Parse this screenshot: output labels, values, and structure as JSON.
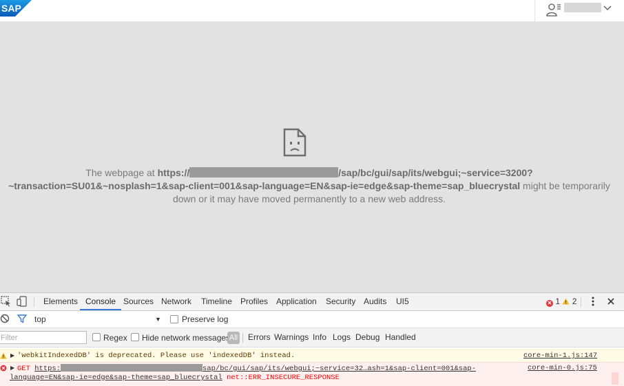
{
  "header": {
    "logo_text": "SAP",
    "brand_color": "#0a6ed1",
    "user_icon": "user-icon",
    "menu_icon": "chevron-down-icon"
  },
  "page_error": {
    "icon": "sad-document-icon",
    "prefix": "The webpage at ",
    "url_start": "https://",
    "url_path": "/sap/bc/gui/sap/its/webgui;~service=3200?",
    "url_line2": "~transaction=SU01&~nosplash=1&sap-client=001&sap-language=EN&sap-ie=edge&sap-theme=sap_bluecrystal",
    "suffix_line2": " might be temporarily",
    "line3": "down or it may have moved permanently to a new web address."
  },
  "devtools": {
    "tabs": [
      "Elements",
      "Console",
      "Sources",
      "Network",
      "Timeline",
      "Profiles",
      "Application",
      "Security",
      "Audits",
      "UI5"
    ],
    "active_tab": "Console",
    "error_count": "1",
    "warning_count": "2",
    "context": "top",
    "preserve_log_label": "Preserve log",
    "filter_placeholder": "Filter",
    "regex_label": "Regex",
    "hide_network_label": "Hide network messages",
    "levels": [
      "All",
      "Errors",
      "Warnings",
      "Info",
      "Logs",
      "Debug",
      "Handled"
    ],
    "messages": [
      {
        "type": "warning",
        "text": "'webkitIndexedDB' is deprecated. Please use 'indexedDB' instead.",
        "source": "core-min-1.js:147"
      },
      {
        "type": "error",
        "method": "GET",
        "url_start": "https:",
        "url_rest": "sap/bc/gui/sap/its/webgui;~service=32…ash=1&sap-client=001&sap-",
        "url_line2": "language=EN&sap-ie=edge&sap-theme=sap_bluecrystal",
        "error_code": "net::ERR_INSECURE_RESPONSE",
        "source": "core-min-0.js:75"
      }
    ]
  }
}
